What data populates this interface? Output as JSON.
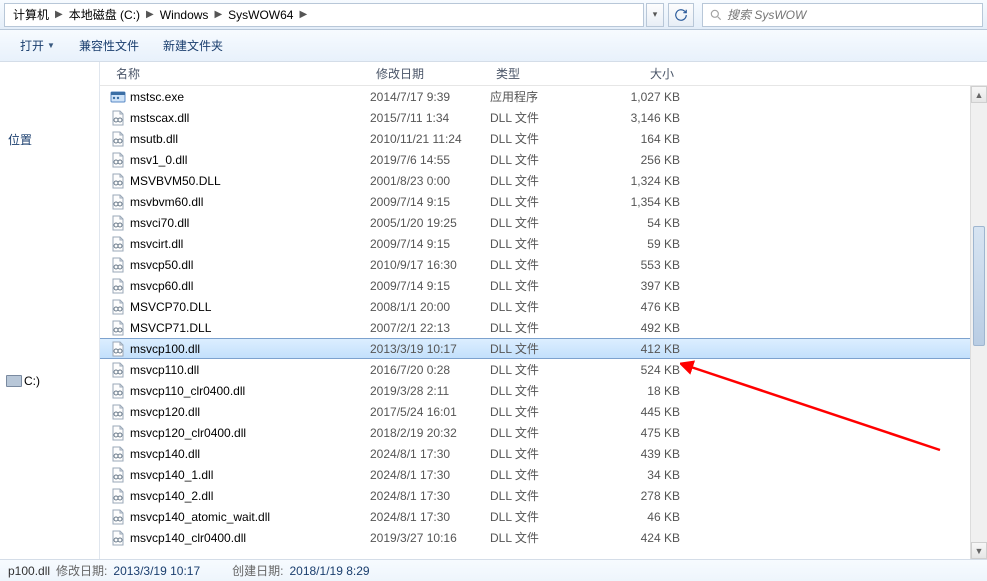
{
  "breadcrumbs": [
    "计算机",
    "本地磁盘 (C:)",
    "Windows",
    "SysWOW64"
  ],
  "search_placeholder": "搜索 SysWOW",
  "toolbar": {
    "open": "打开",
    "compat": "兼容性文件",
    "newfolder": "新建文件夹"
  },
  "nav": {
    "location": "位置",
    "drive": "C:)"
  },
  "columns": {
    "name": "名称",
    "date": "修改日期",
    "type": "类型",
    "size": "大小"
  },
  "type_labels": {
    "app": "应用程序",
    "dll": "DLL 文件"
  },
  "files": [
    {
      "name": "mstsc.exe",
      "date": "2014/7/17 9:39",
      "type": "app",
      "size": "1,027 KB",
      "icon": "exe",
      "selected": false
    },
    {
      "name": "mstscax.dll",
      "date": "2015/7/11 1:34",
      "type": "dll",
      "size": "3,146 KB",
      "icon": "dll",
      "selected": false
    },
    {
      "name": "msutb.dll",
      "date": "2010/11/21 11:24",
      "type": "dll",
      "size": "164 KB",
      "icon": "dll",
      "selected": false
    },
    {
      "name": "msv1_0.dll",
      "date": "2019/7/6 14:55",
      "type": "dll",
      "size": "256 KB",
      "icon": "dll",
      "selected": false
    },
    {
      "name": "MSVBVM50.DLL",
      "date": "2001/8/23 0:00",
      "type": "dll",
      "size": "1,324 KB",
      "icon": "dll",
      "selected": false
    },
    {
      "name": "msvbvm60.dll",
      "date": "2009/7/14 9:15",
      "type": "dll",
      "size": "1,354 KB",
      "icon": "dll",
      "selected": false
    },
    {
      "name": "msvci70.dll",
      "date": "2005/1/20 19:25",
      "type": "dll",
      "size": "54 KB",
      "icon": "dll",
      "selected": false
    },
    {
      "name": "msvcirt.dll",
      "date": "2009/7/14 9:15",
      "type": "dll",
      "size": "59 KB",
      "icon": "dll",
      "selected": false
    },
    {
      "name": "msvcp50.dll",
      "date": "2010/9/17 16:30",
      "type": "dll",
      "size": "553 KB",
      "icon": "dll",
      "selected": false
    },
    {
      "name": "msvcp60.dll",
      "date": "2009/7/14 9:15",
      "type": "dll",
      "size": "397 KB",
      "icon": "dll",
      "selected": false
    },
    {
      "name": "MSVCP70.DLL",
      "date": "2008/1/1 20:00",
      "type": "dll",
      "size": "476 KB",
      "icon": "dll",
      "selected": false
    },
    {
      "name": "MSVCP71.DLL",
      "date": "2007/2/1 22:13",
      "type": "dll",
      "size": "492 KB",
      "icon": "dll",
      "selected": false
    },
    {
      "name": "msvcp100.dll",
      "date": "2013/3/19 10:17",
      "type": "dll",
      "size": "412 KB",
      "icon": "dll",
      "selected": true
    },
    {
      "name": "msvcp110.dll",
      "date": "2016/7/20 0:28",
      "type": "dll",
      "size": "524 KB",
      "icon": "dll",
      "selected": false
    },
    {
      "name": "msvcp110_clr0400.dll",
      "date": "2019/3/28 2:11",
      "type": "dll",
      "size": "18 KB",
      "icon": "dll",
      "selected": false
    },
    {
      "name": "msvcp120.dll",
      "date": "2017/5/24 16:01",
      "type": "dll",
      "size": "445 KB",
      "icon": "dll",
      "selected": false
    },
    {
      "name": "msvcp120_clr0400.dll",
      "date": "2018/2/19 20:32",
      "type": "dll",
      "size": "475 KB",
      "icon": "dll",
      "selected": false
    },
    {
      "name": "msvcp140.dll",
      "date": "2024/8/1 17:30",
      "type": "dll",
      "size": "439 KB",
      "icon": "dll",
      "selected": false
    },
    {
      "name": "msvcp140_1.dll",
      "date": "2024/8/1 17:30",
      "type": "dll",
      "size": "34 KB",
      "icon": "dll",
      "selected": false
    },
    {
      "name": "msvcp140_2.dll",
      "date": "2024/8/1 17:30",
      "type": "dll",
      "size": "278 KB",
      "icon": "dll",
      "selected": false
    },
    {
      "name": "msvcp140_atomic_wait.dll",
      "date": "2024/8/1 17:30",
      "type": "dll",
      "size": "46 KB",
      "icon": "dll",
      "selected": false
    },
    {
      "name": "msvcp140_clr0400.dll",
      "date": "2019/3/27 10:16",
      "type": "dll",
      "size": "424 KB",
      "icon": "dll",
      "selected": false
    }
  ],
  "details": {
    "file_fragment": "p100.dll",
    "date_label": "修改日期:",
    "date_value": "2013/3/19 10:17",
    "created_label": "创建日期:",
    "created_value": "2018/1/19 8:29"
  }
}
